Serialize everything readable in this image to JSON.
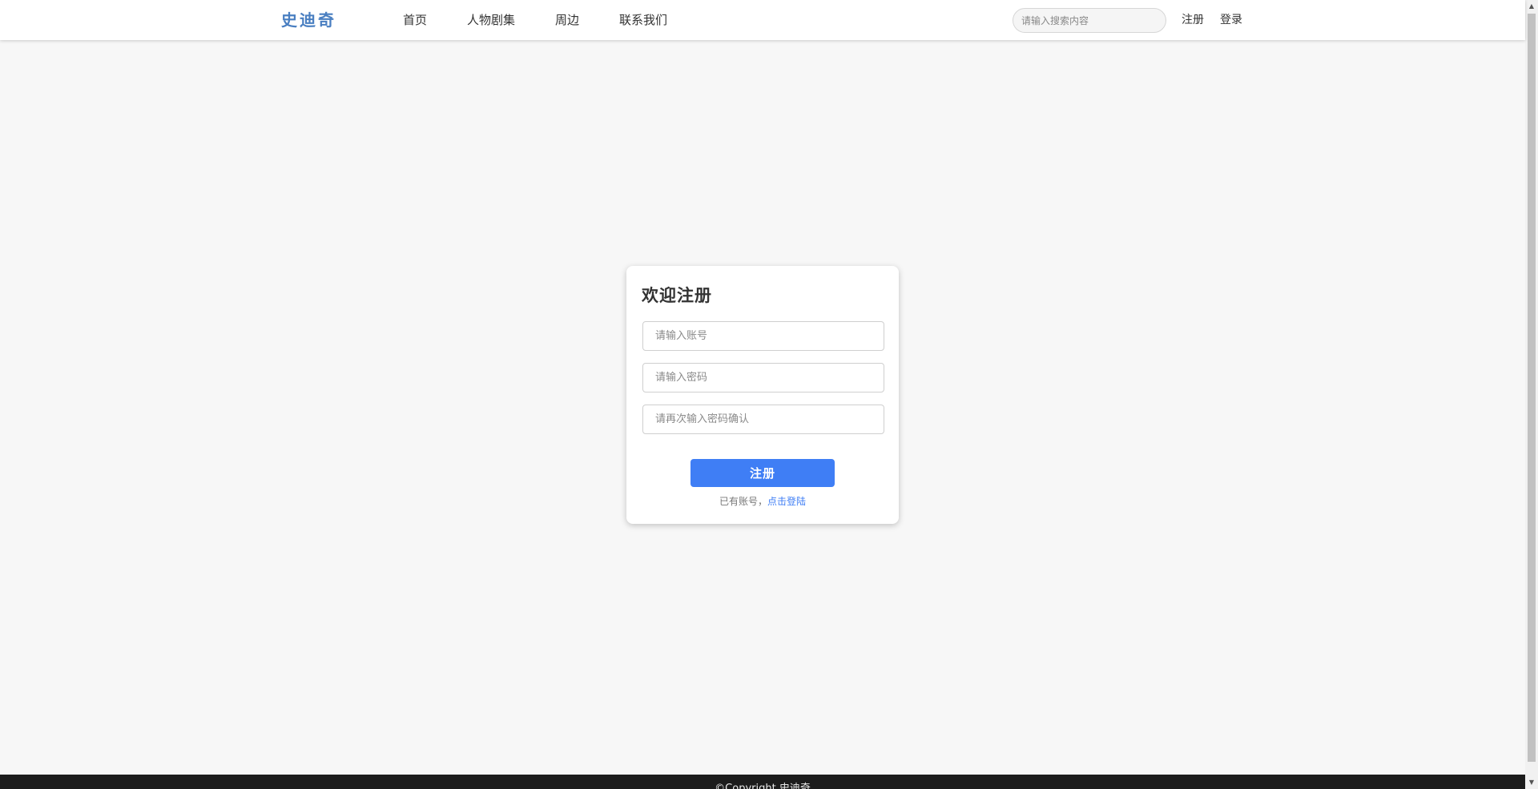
{
  "header": {
    "logo": "史迪奇",
    "nav": [
      {
        "label": "首页"
      },
      {
        "label": "人物剧集"
      },
      {
        "label": "周边"
      },
      {
        "label": "联系我们"
      }
    ],
    "search": {
      "placeholder": "请输入搜索内容",
      "value": ""
    },
    "register_label": "注册",
    "login_label": "登录"
  },
  "register_form": {
    "title": "欢迎注册",
    "account": {
      "placeholder": "请输入账号",
      "value": ""
    },
    "password": {
      "placeholder": "请输入密码",
      "value": ""
    },
    "confirm_password": {
      "placeholder": "请再次输入密码确认",
      "value": ""
    },
    "submit_label": "注册",
    "login_hint": "已有账号，",
    "login_link": "点击登陆"
  },
  "footer": {
    "copyright": "©Copyright 史迪奇"
  },
  "colors": {
    "accent": "#3f7ef5",
    "logo": "#4a7fc1",
    "background": "#f7f7f7",
    "footer": "#1c1c1c"
  },
  "icons": {
    "scroll_up": "triangle-up-icon",
    "scroll_down": "triangle-down-icon"
  }
}
